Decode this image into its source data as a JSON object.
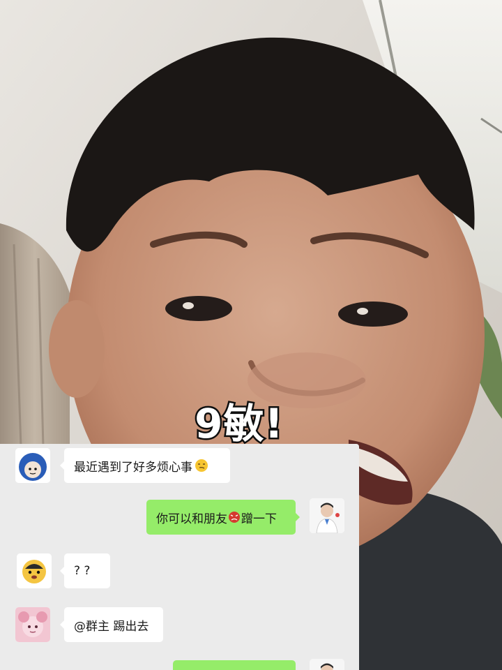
{
  "caption": "9敏!",
  "messages": [
    {
      "side": "left",
      "avatar": "blue-cartoon-avatar",
      "text": "最近遇到了好多烦心事",
      "emoji": "smirk-emoji"
    },
    {
      "side": "right",
      "avatar": "doctor-avatar",
      "text_before": "你可以和朋友",
      "inline_icon": "angry-face-sticker",
      "text_after": "蹭一下"
    },
    {
      "side": "left",
      "avatar": "yellow-cartoon-avatar",
      "text": "? ?"
    },
    {
      "side": "left",
      "avatar": "pink-cartoon-avatar",
      "text": "@群主 踢出去"
    },
    {
      "side": "right",
      "avatar": "doctor-avatar",
      "text": ""
    }
  ],
  "colors": {
    "chat_bg": "#ebebeb",
    "bubble_left": "#ffffff",
    "bubble_right": "#95ec69",
    "caption_fill": "#ffffff",
    "caption_stroke": "#111111"
  }
}
